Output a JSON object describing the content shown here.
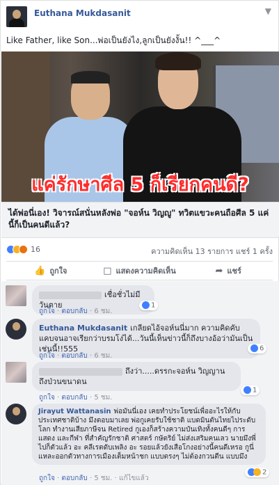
{
  "post": {
    "author": "Euthana Mukdasanit",
    "caption": "Like Father, like Son...พ่อเป็นยังไง,ลูกเป็นยังงั้น!! ^___^",
    "image_overlay_text": "แค่รักษาศีล 5 ก็เรียกคนดี?",
    "link_title": "ได้พ่อนี่เอง! วิจารณ์สนั่นหลังพ่อ \"จอห์น วิญญู\" ทวิตแขวะคนถือศีล 5 แค่นี้ก็เป็นคนดีแล้ว?",
    "reaction_count": "16",
    "stats_right": "ความคิดเห็น 13 รายการ  แชร์ 1 ครั้ง",
    "actions": {
      "like": "ถูกใจ",
      "comment": "แสดงความคิดเห็น",
      "share": "แชร์"
    }
  },
  "comments": [
    {
      "name": "",
      "text": "เชื่อชั่วไม่มีวันตาย",
      "meta_like": "ถูกใจ",
      "meta_reply": "ตอบกลับ",
      "meta_time": "6 ชม.",
      "likes": "1"
    },
    {
      "name": "Euthana Mukdasanit",
      "text": "เกลียดไอ้จอห์นนี่มาก ความคิดคับแคบจนอาจเรียกว่าบรมโง่ได้...วันนี้เห็นข่าวนี้ก็ถึงบางอ้อว่ามันเป็นเช่นนี้!!555",
      "meta_like": "ถูกใจ",
      "meta_reply": "ตอบกลับ",
      "meta_time": "6 ชม.",
      "likes": "6"
    },
    {
      "name": "",
      "text": "ถึงว่า.....ดรรกะจอห์น วิญญาน ถึงป่วนขนาดน",
      "meta_like": "ถูกใจ",
      "meta_reply": "ตอบกลับ",
      "meta_time": "5 ชม.",
      "likes": "1"
    },
    {
      "name": "Jirayut Wattanasin",
      "text": "พ่อมันนี่เอง เคยทำประโยชน์เพื่ออะไรให้กับประเทศชาติบ้าง มึงตอบมาเลย พ่อกูเคยรับใช้ชาติ แบดมินตันไทยไประดับโลก ทำงานเสียภาษีจน Retired กูเองก็สร้างความบันเทิงทั้งคนดีๆ การแสดง และกีฬา ที่สำคัญรักชาติ ศาสตร์ กษัตริย์ ไม่ส่งเสริมคนเลว นายมึงพี่ไปก็ตัวแล้ว อะ คลีเรตดับเพลิง อะ รอยแล้วยังเสือโกงอย่างนี้คนดีเหรอ กูนี่แหละออกตัวทางการเมืองเต็มหน้าชก แบบตรงๆ ไม่ต้องกวนตีน แบบมึง",
      "meta_like": "ถูกใจ",
      "meta_reply": "ตอบกลับ",
      "meta_time": "5 ชม.",
      "meta_edited": "แก้ไขแล้ว",
      "likes": "2"
    }
  ]
}
